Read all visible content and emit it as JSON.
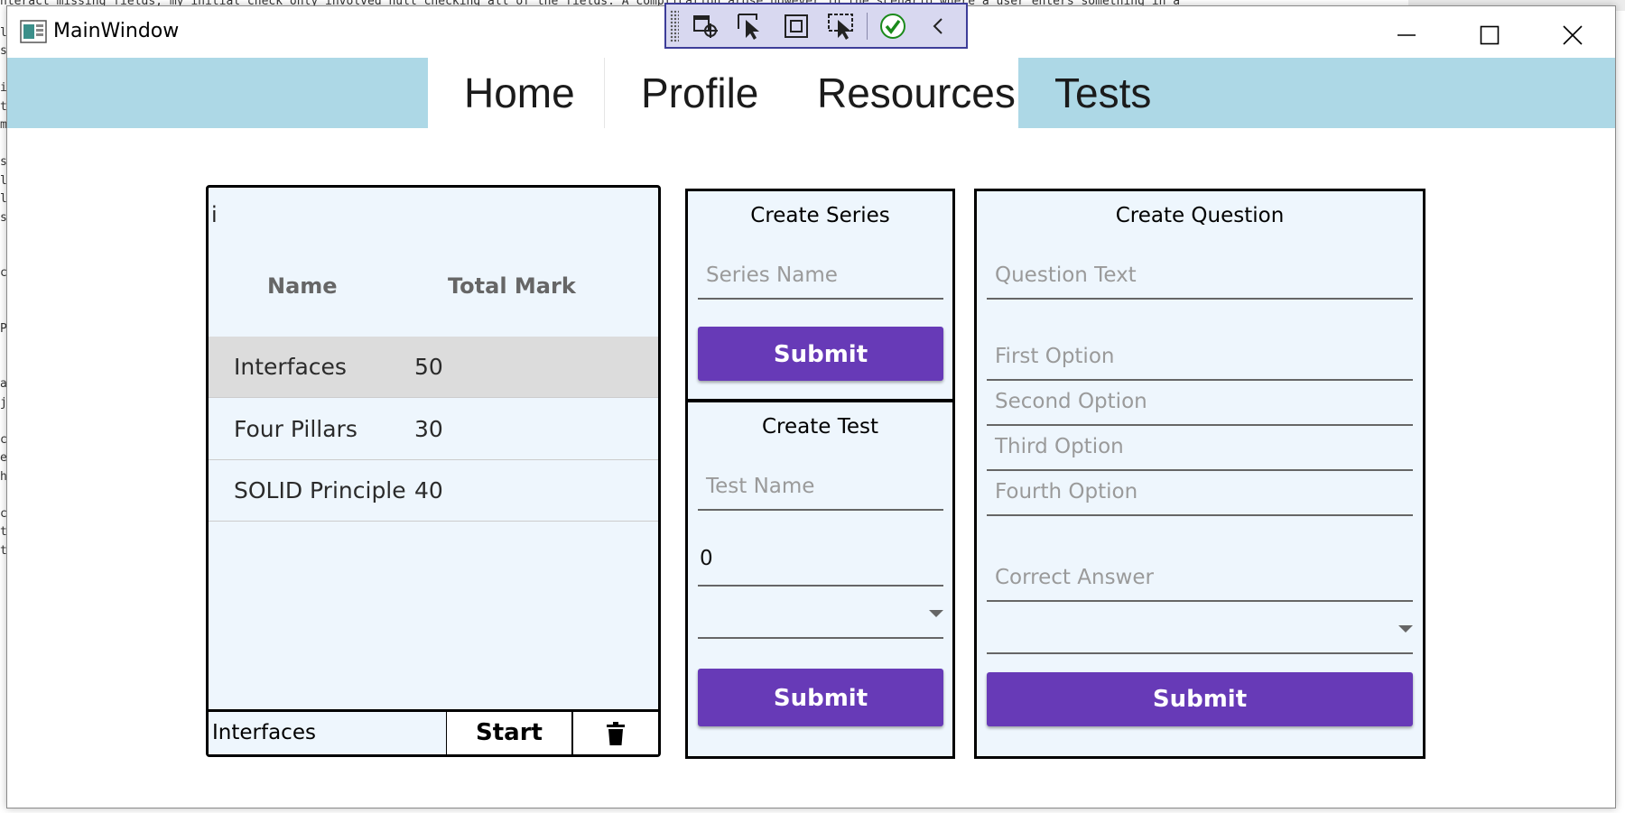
{
  "background_editor": {
    "lines": [
      "nteract missing fields, my initial check only involved null checking all of the fields. A complication arose however in the scenario where a user enters something in a",
      "l",
      "s",
      "",
      "i",
      "t",
      "m",
      "",
      "s",
      "l",
      "l",
      "s",
      "",
      "",
      "c",
      "",
      "",
      "P",
      "",
      "",
      "a",
      "j",
      "",
      "c",
      "e",
      "h",
      "",
      "c",
      "t",
      "t"
    ]
  },
  "window": {
    "title": "MainWindow"
  },
  "nav": {
    "tabs": [
      "Home",
      "Profile",
      "Resources",
      "Tests"
    ],
    "active": "Tests"
  },
  "tests_panel": {
    "top_text": "i",
    "columns": {
      "name": "Name",
      "total_mark": "Total Mark"
    },
    "rows": [
      {
        "name": "Interfaces",
        "mark": "50"
      },
      {
        "name": "Four Pillars",
        "mark": "30"
      },
      {
        "name": "SOLID Principle",
        "mark": "40"
      }
    ],
    "footer": {
      "selected_value": "Interfaces",
      "start_label": "Start"
    }
  },
  "create_series": {
    "title": "Create Series",
    "name_placeholder": "Series Name",
    "submit_label": "Submit"
  },
  "create_test": {
    "title": "Create Test",
    "name_placeholder": "Test Name",
    "mark_value": "0",
    "series_selected": "",
    "submit_label": "Submit"
  },
  "create_question": {
    "title": "Create Question",
    "question_placeholder": "Question Text",
    "option1_placeholder": "First Option",
    "option2_placeholder": "Second Option",
    "option3_placeholder": "Third Option",
    "option4_placeholder": "Fourth Option",
    "answer_placeholder": "Correct Answer",
    "test_selected": "",
    "submit_label": "Submit"
  },
  "colors": {
    "nav_background": "#add8e6",
    "panel_background": "#eef6fd",
    "accent": "#673ab7",
    "selected_row": "#dcdcdc"
  }
}
